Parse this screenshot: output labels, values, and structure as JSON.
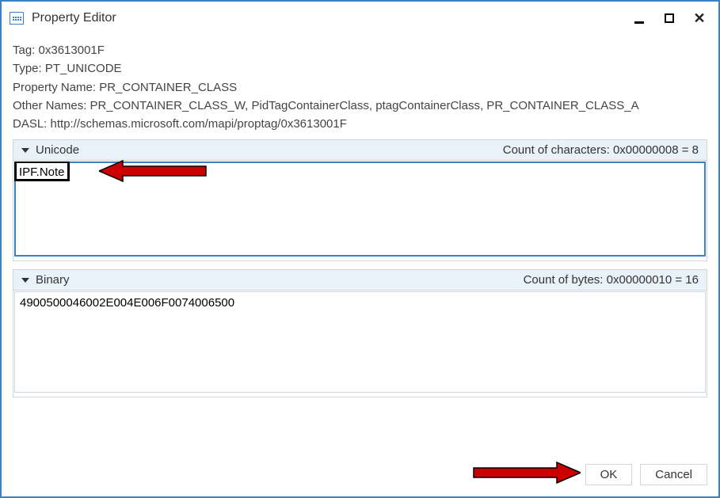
{
  "window": {
    "title": "Property Editor"
  },
  "info": {
    "tag_label": "Tag:",
    "tag_value": "0x3613001F",
    "type_label": "Type:",
    "type_value": "PT_UNICODE",
    "propname_label": "Property Name:",
    "propname_value": "PR_CONTAINER_CLASS",
    "othernames_label": "Other Names:",
    "othernames_value": "PR_CONTAINER_CLASS_W, PidTagContainerClass, ptagContainerClass, PR_CONTAINER_CLASS_A",
    "dasl_label": "DASL:",
    "dasl_value": "http://schemas.microsoft.com/mapi/proptag/0x3613001F"
  },
  "unicode_panel": {
    "header": "Unicode",
    "count_label": "Count of characters: 0x00000008 = 8",
    "value": "IPF.Note"
  },
  "binary_panel": {
    "header": "Binary",
    "count_label": "Count of bytes: 0x00000010 = 16",
    "value": "4900500046002E004E006F0074006500"
  },
  "buttons": {
    "ok": "OK",
    "cancel": "Cancel"
  }
}
